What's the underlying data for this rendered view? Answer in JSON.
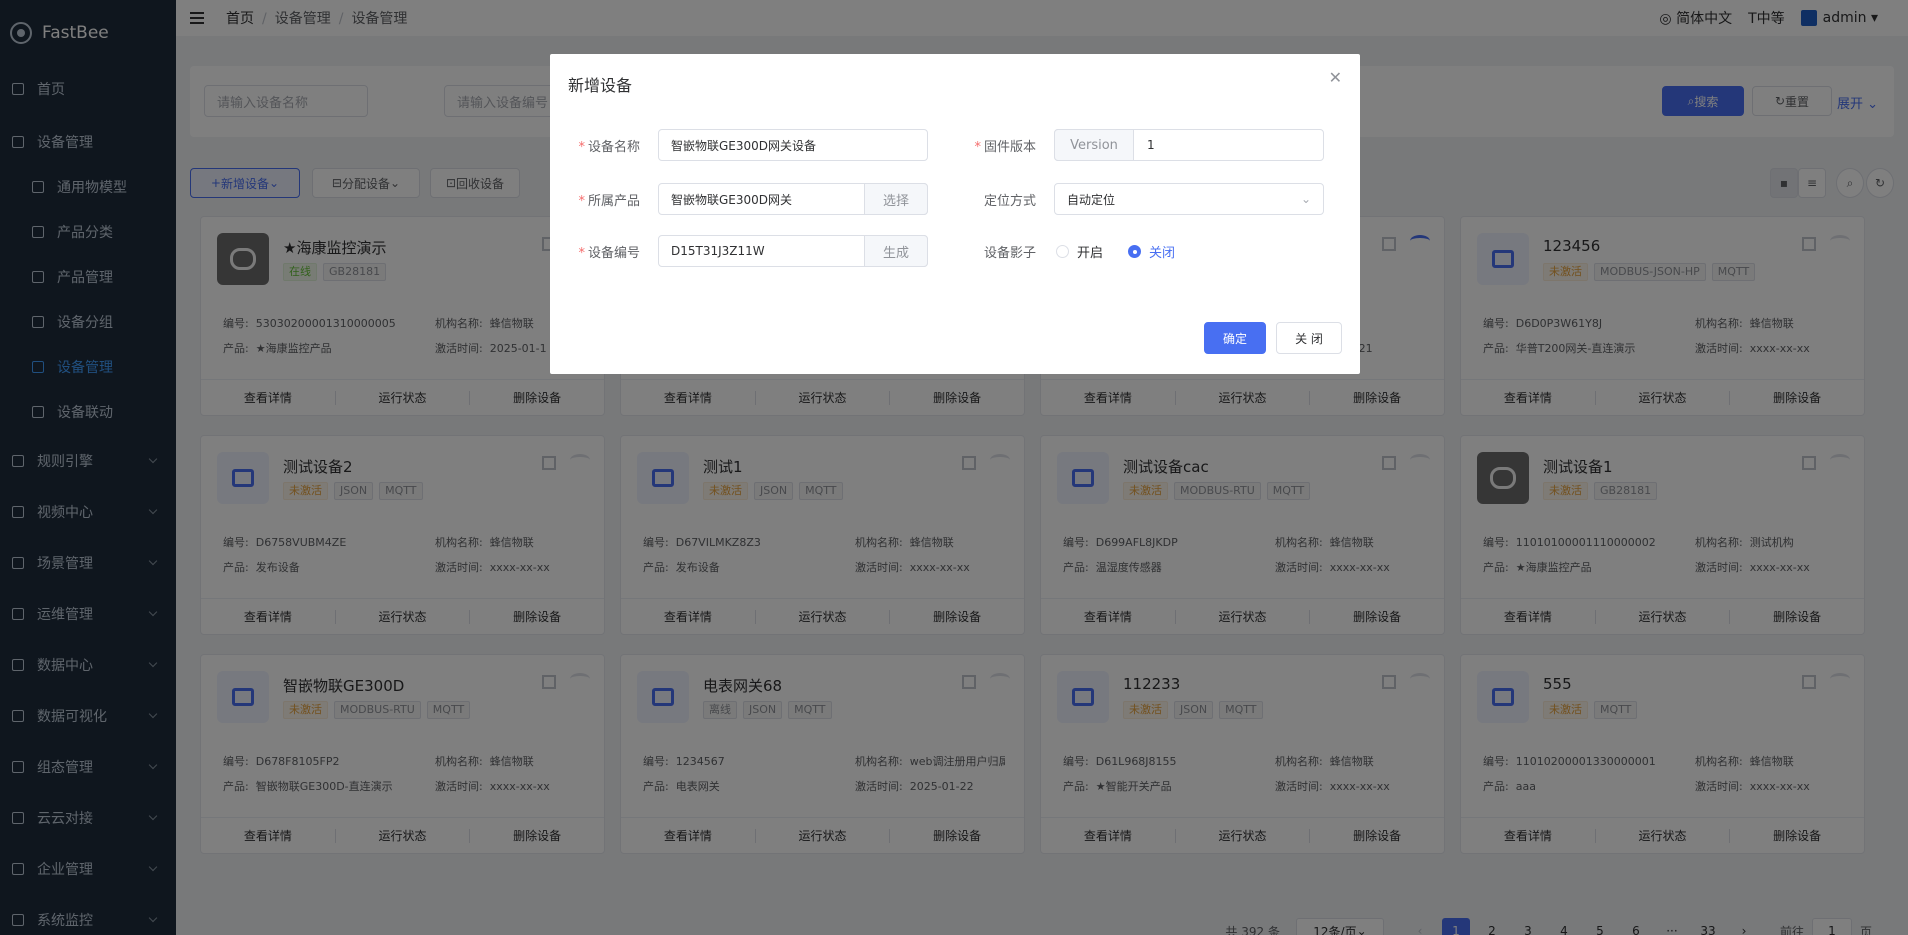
{
  "app": {
    "name": "FastBee"
  },
  "sidebar": {
    "items": [
      {
        "label": "首页",
        "icon": "home-icon"
      },
      {
        "label": "设备管理",
        "icon": "monitor-icon"
      },
      {
        "label": "通用物模型",
        "icon": "model-icon"
      },
      {
        "label": "产品分类",
        "icon": "category-icon"
      },
      {
        "label": "产品管理",
        "icon": "product-icon"
      },
      {
        "label": "设备分组",
        "icon": "group-icon"
      },
      {
        "label": "设备管理",
        "icon": "device-icon"
      },
      {
        "label": "设备联动",
        "icon": "link-icon"
      },
      {
        "label": "规则引擎",
        "icon": "rule-icon"
      },
      {
        "label": "视频中心",
        "icon": "video-icon"
      },
      {
        "label": "场景管理",
        "icon": "scene-icon"
      },
      {
        "label": "运维管理",
        "icon": "ops-icon"
      },
      {
        "label": "数据中心",
        "icon": "data-icon"
      },
      {
        "label": "数据可视化",
        "icon": "chart-icon"
      },
      {
        "label": "组态管理",
        "icon": "layer-icon"
      },
      {
        "label": "云云对接",
        "icon": "cloud-icon"
      },
      {
        "label": "企业管理",
        "icon": "enterprise-icon"
      },
      {
        "label": "系统监控",
        "icon": "system-monitor-icon"
      }
    ]
  },
  "navbar": {
    "breadcrumb": [
      "首页",
      "设备管理",
      "设备管理"
    ],
    "lang": "简体中文",
    "size": "中等",
    "user": "admin"
  },
  "search": {
    "name_placeholder": "请输入设备名称",
    "code_placeholder": "请输入设备编号",
    "search_btn": "搜索",
    "reset_btn": "重置",
    "expand_btn": "展开"
  },
  "toolbar": {
    "add": "新增设备",
    "assign": "分配设备",
    "recycle": "回收设备"
  },
  "card_actions": {
    "detail": "查看详情",
    "status": "运行状态",
    "delete": "删除设备"
  },
  "info_labels": {
    "code": "编号:",
    "product": "产品:",
    "org": "机构名称:",
    "active": "激活时间:"
  },
  "cards": [
    {
      "name": "★海康监控演示",
      "tags": [
        "在线",
        "GB28181"
      ],
      "code": "53030200001310000005",
      "org": "蜂信物联",
      "product": "★海康监控产品",
      "active": "2025-01-1"
    },
    {
      "name": "",
      "tags": [],
      "code": "",
      "org": "",
      "product": "",
      "active": ""
    },
    {
      "name": "",
      "tags": [],
      "code": "",
      "org": "物联",
      "product": "",
      "active": "5-01-21"
    },
    {
      "name": "123456",
      "tags": [
        "未激活",
        "MODBUS-JSON-HP",
        "MQTT"
      ],
      "code": "D6D0P3W61Y8J",
      "org": "蜂信物联",
      "product": "华普T200网关-直连演示",
      "active": "xxxx-xx-xx"
    },
    {
      "name": "测试设备2",
      "tags": [
        "未激活",
        "JSON",
        "MQTT"
      ],
      "code": "D6758VUBM4ZE",
      "org": "蜂信物联",
      "product": "发布设备",
      "active": "xxxx-xx-xx"
    },
    {
      "name": "测试1",
      "tags": [
        "未激活",
        "JSON",
        "MQTT"
      ],
      "code": "D67VILMKZ8Z3",
      "org": "蜂信物联",
      "product": "发布设备",
      "active": "xxxx-xx-xx"
    },
    {
      "name": "测试设备cac",
      "tags": [
        "未激活",
        "MODBUS-RTU",
        "MQTT"
      ],
      "code": "D699AFL8JKDP",
      "org": "蜂信物联",
      "product": "温湿度传感器",
      "active": "xxxx-xx-xx"
    },
    {
      "name": "测试设备1",
      "tags": [
        "未激活",
        "GB28181"
      ],
      "code": "11010100001110000002",
      "org": "测试机构",
      "product": "★海康监控产品",
      "active": "xxxx-xx-xx"
    },
    {
      "name": "智嵌物联GE300D",
      "tags": [
        "未激活",
        "MODBUS-RTU",
        "MQTT"
      ],
      "code": "D678F8105FP2",
      "org": "蜂信物联",
      "product": "智嵌物联GE300D-直连演示",
      "active": "xxxx-xx-xx"
    },
    {
      "name": "电表网关68",
      "tags": [
        "离线",
        "JSON",
        "MQTT"
      ],
      "code": "1234567",
      "org": "web调注册用户归属机",
      "product": "电表网关",
      "active": "2025-01-22"
    },
    {
      "name": "112233",
      "tags": [
        "未激活",
        "JSON",
        "MQTT"
      ],
      "code": "D61L968J8155",
      "org": "蜂信物联",
      "product": "★智能开关产品",
      "active": "xxxx-xx-xx"
    },
    {
      "name": "555",
      "tags": [
        "未激活",
        "MQTT"
      ],
      "code": "11010200001330000001",
      "org": "蜂信物联",
      "product": "aaa",
      "active": "xxxx-xx-xx"
    }
  ],
  "pager": {
    "total": "共 392 条",
    "size": "12条/页",
    "pages": [
      "1",
      "2",
      "3",
      "4",
      "5",
      "6",
      "···",
      "33"
    ],
    "goto": "前往",
    "goto_value": "1",
    "page_unit": "页"
  },
  "dialog": {
    "title": "新增设备",
    "device_name_label": "设备名称",
    "device_name_value": "智嵌物联GE300D网关设备",
    "firmware_label": "固件版本",
    "firmware_prefix": "Version",
    "firmware_value": "1",
    "product_label": "所属产品",
    "product_value": "智嵌物联GE300D网关",
    "product_btn": "选择",
    "locate_label": "定位方式",
    "locate_value": "自动定位",
    "serial_label": "设备编号",
    "serial_value": "D15T31J3Z11W",
    "serial_btn": "生成",
    "shadow_label": "设备影子",
    "shadow_on": "开启",
    "shadow_off": "关闭",
    "confirm": "确定",
    "cancel": "关 闭"
  }
}
